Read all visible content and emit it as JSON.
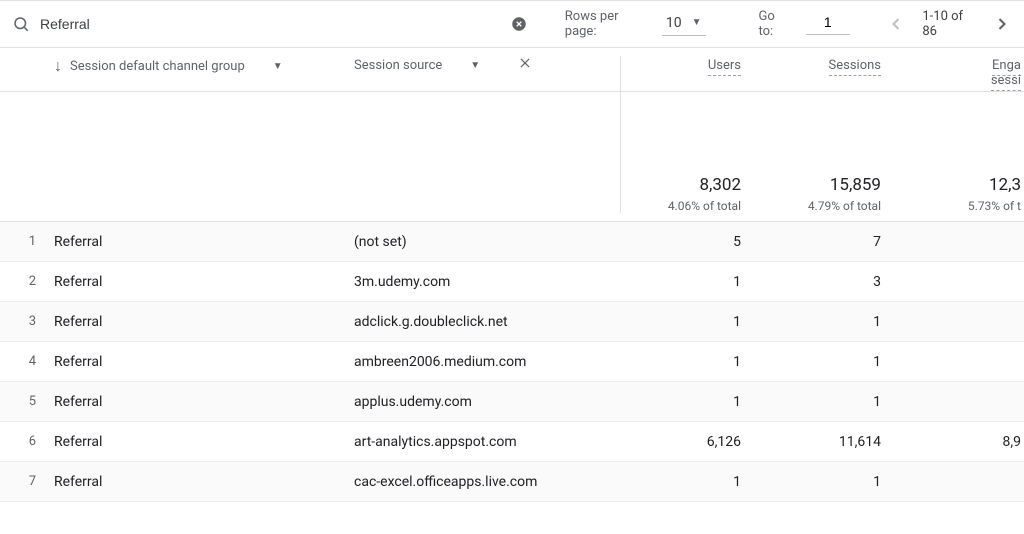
{
  "toolbar": {
    "search_value": "Referral",
    "rows_per_page_label": "Rows per page:",
    "rows_per_page_value": "10",
    "goto_label": "Go to:",
    "goto_value": "1",
    "range_label": "1-10 of 86"
  },
  "columns": {
    "dimension1": "Session default channel group",
    "dimension2": "Session source",
    "metric1": "Users",
    "metric2": "Sessions",
    "metric3_line1": "Enga",
    "metric3_line2": "sessi"
  },
  "totals": {
    "users_value": "8,302",
    "users_pct": "4.06% of total",
    "sessions_value": "15,859",
    "sessions_pct": "4.79% of total",
    "engaged_value": "12,3",
    "engaged_pct": "5.73% of t"
  },
  "rows": [
    {
      "n": "1",
      "channel": "Referral",
      "source": "(not set)",
      "users": "5",
      "sessions": "7",
      "engaged": ""
    },
    {
      "n": "2",
      "channel": "Referral",
      "source": "3m.udemy.com",
      "users": "1",
      "sessions": "3",
      "engaged": ""
    },
    {
      "n": "3",
      "channel": "Referral",
      "source": "adclick.g.doubleclick.net",
      "users": "1",
      "sessions": "1",
      "engaged": ""
    },
    {
      "n": "4",
      "channel": "Referral",
      "source": "ambreen2006.medium.com",
      "users": "1",
      "sessions": "1",
      "engaged": ""
    },
    {
      "n": "5",
      "channel": "Referral",
      "source": "applus.udemy.com",
      "users": "1",
      "sessions": "1",
      "engaged": ""
    },
    {
      "n": "6",
      "channel": "Referral",
      "source": "art-analytics.appspot.com",
      "users": "6,126",
      "sessions": "11,614",
      "engaged": "8,9"
    },
    {
      "n": "7",
      "channel": "Referral",
      "source": "cac-excel.officeapps.live.com",
      "users": "1",
      "sessions": "1",
      "engaged": ""
    }
  ]
}
